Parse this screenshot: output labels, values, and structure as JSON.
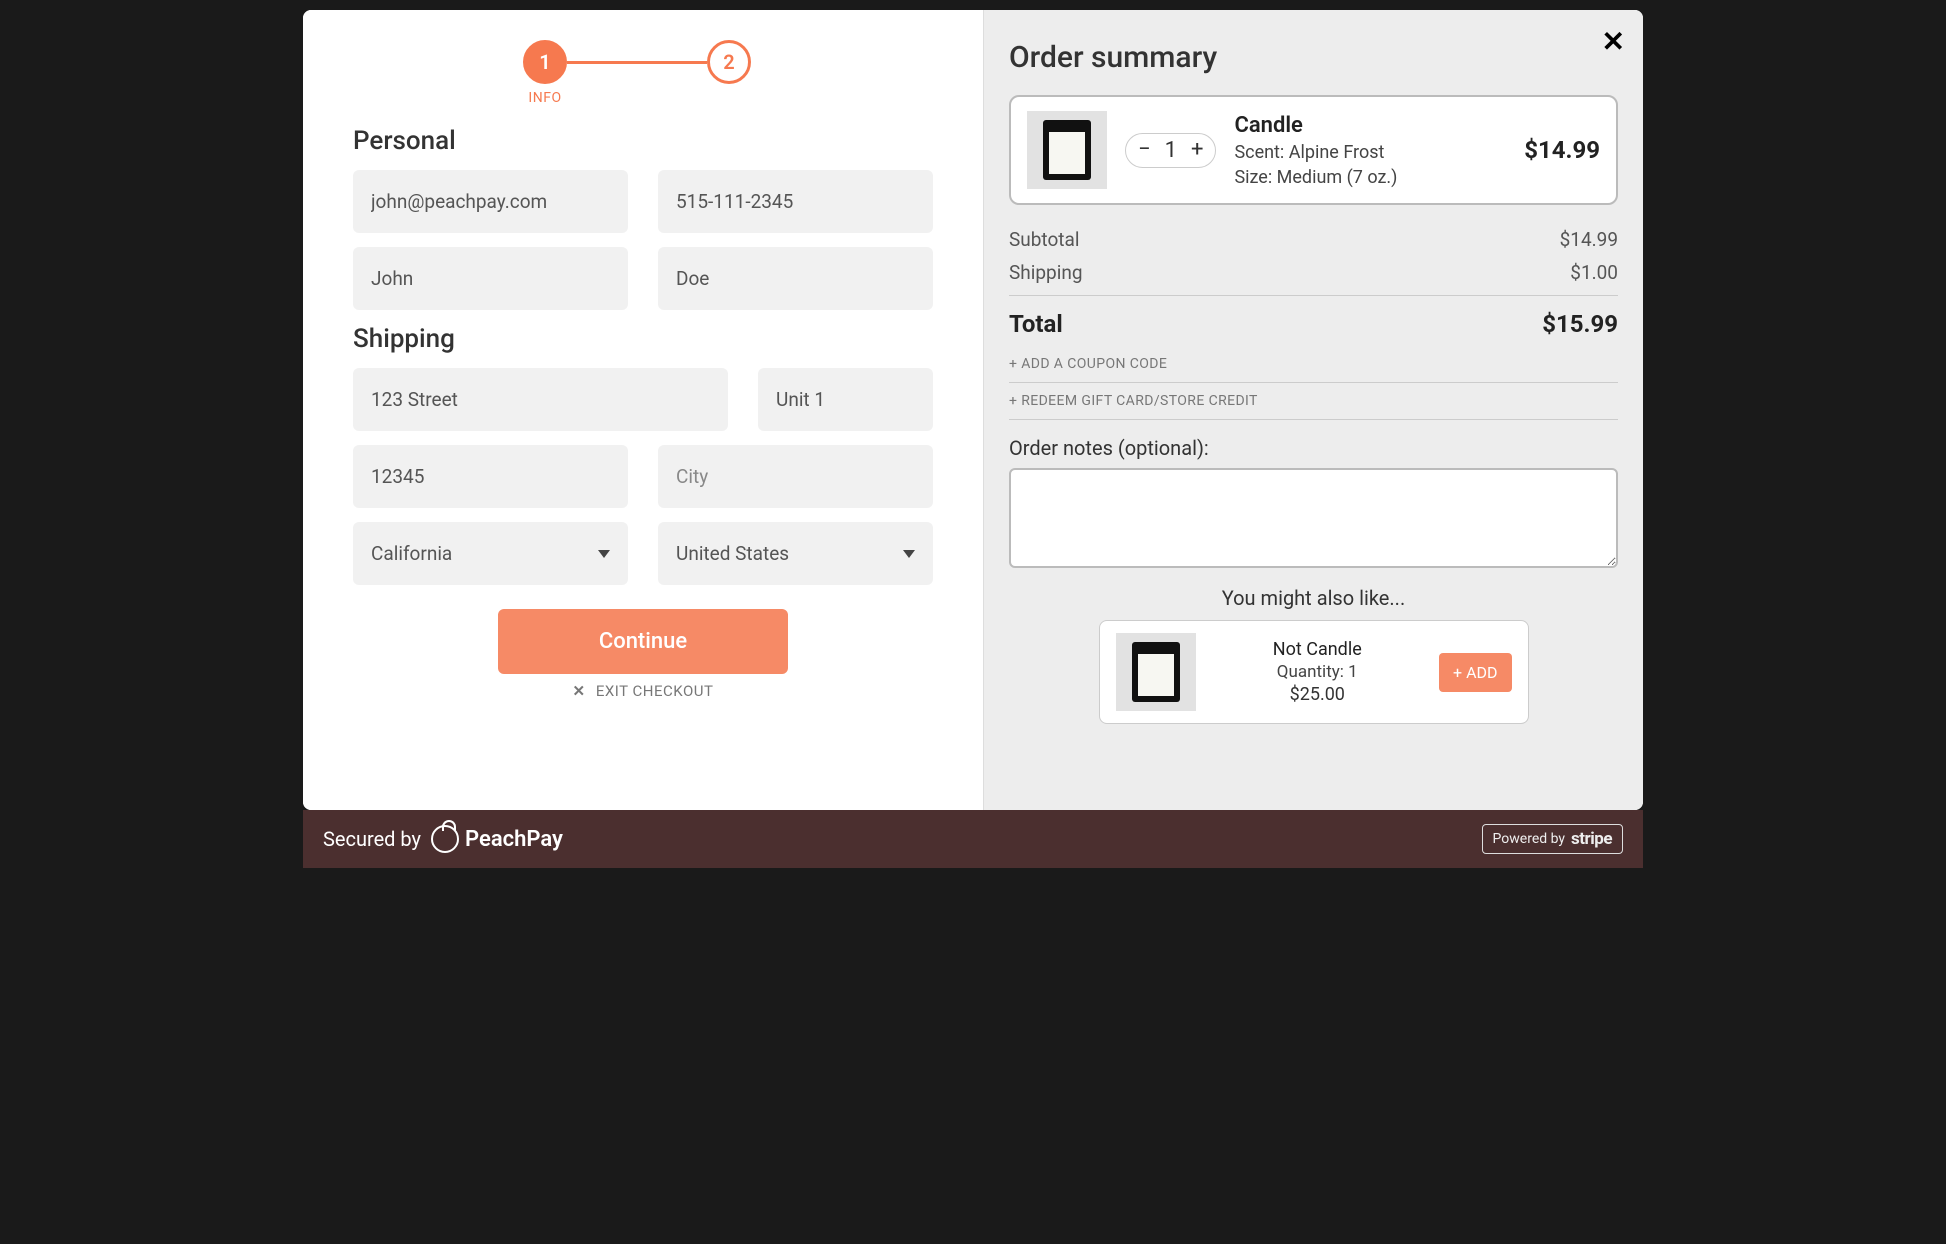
{
  "stepper": {
    "steps": [
      {
        "num": "1",
        "label": "INFO"
      },
      {
        "num": "2",
        "label": ""
      }
    ]
  },
  "personal": {
    "title": "Personal",
    "email": "john@peachpay.com",
    "phone": "515-111-2345",
    "first_name": "John",
    "last_name": "Doe"
  },
  "shipping": {
    "title": "Shipping",
    "address1": "123 Street",
    "address2": "Unit 1",
    "postal": "12345",
    "city_placeholder": "City",
    "state": "California",
    "country": "United States"
  },
  "buttons": {
    "continue": "Continue",
    "exit": "EXIT CHECKOUT"
  },
  "summary": {
    "title": "Order summary",
    "item": {
      "name": "Candle",
      "scent_label": "Scent: Alpine Frost",
      "size_label": "Size: Medium (7 oz.)",
      "qty": "1",
      "price": "$14.99"
    },
    "subtotal_label": "Subtotal",
    "subtotal_value": "$14.99",
    "shipping_label": "Shipping",
    "shipping_value": "$1.00",
    "total_label": "Total",
    "total_value": "$15.99",
    "coupon_link": "+ ADD A COUPON CODE",
    "giftcard_link": "+ REDEEM GIFT CARD/STORE CREDIT",
    "notes_label": "Order notes (optional):"
  },
  "upsell": {
    "title": "You might also like...",
    "name": "Not Candle",
    "qty_label": "Quantity: 1",
    "price": "$25.00",
    "add_label": "+ ADD"
  },
  "footer": {
    "secured_by": "Secured by",
    "brand": "PeachPay",
    "powered_by": "Powered by",
    "stripe": "stripe"
  }
}
